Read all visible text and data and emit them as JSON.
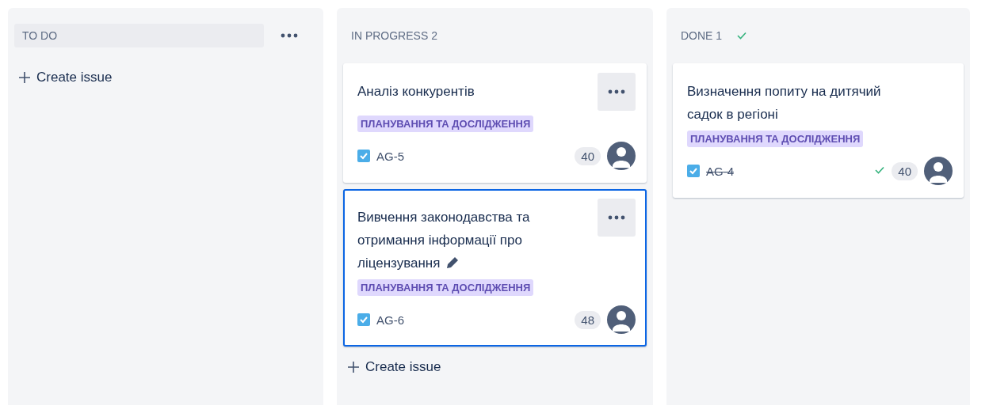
{
  "columns": [
    {
      "title": "TO DO",
      "highlighted": true,
      "menu": true,
      "done_mark": false,
      "create_issue": "Create issue"
    },
    {
      "title": "IN PROGRESS 2",
      "highlighted": false,
      "menu": false,
      "done_mark": false,
      "create_issue": "Create issue",
      "cards": [
        {
          "title": "Аналіз конкурентів",
          "editable": false,
          "selected": false,
          "menu": true,
          "tag": "ПЛАНУВАННЯ ТА ДОСЛІДЖЕННЯ",
          "key": "AG-5",
          "resolved": false,
          "estimate": "40"
        },
        {
          "title": "Вивчення законодавства та отримання інформації про ліцензування",
          "editable": true,
          "selected": true,
          "menu": true,
          "tag": "ПЛАНУВАННЯ ТА ДОСЛІДЖЕННЯ",
          "key": "AG-6",
          "resolved": false,
          "estimate": "48"
        }
      ]
    },
    {
      "title": "DONE 1",
      "highlighted": false,
      "menu": false,
      "done_mark": true,
      "cards": [
        {
          "title": "Визначення попиту на дитячий садок в регіоні",
          "editable": false,
          "selected": false,
          "menu": false,
          "tag": "ПЛАНУВАННЯ ТА ДОСЛІДЖЕННЯ",
          "key": "AG-4",
          "resolved": true,
          "estimate": "40"
        }
      ]
    }
  ]
}
